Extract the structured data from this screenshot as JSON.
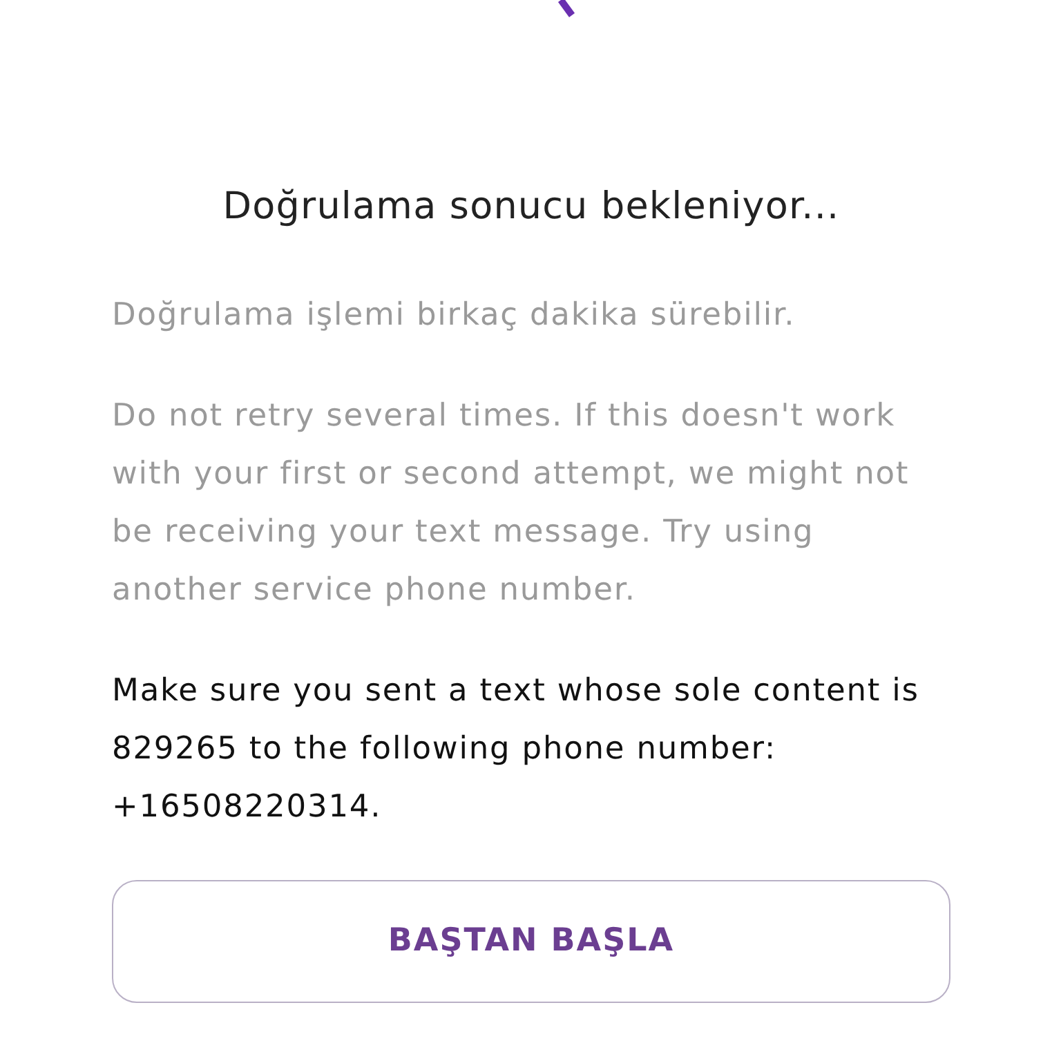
{
  "title": "Doğrulama sonucu bekleniyor...",
  "paragraphs": [
    {
      "kind": "muted",
      "text": "Doğrulama işlemi birkaç dakika sürebilir."
    },
    {
      "kind": "muted",
      "text": "Do not retry several times. If this doesn't work with your first or second attempt, we might not be receiving your text message. Try using another service phone number."
    },
    {
      "kind": "plain",
      "text": "Make sure you sent a text whose sole content is 829265 to the following phone number: +16508220314."
    }
  ],
  "button": {
    "label": "BAŞTAN BAŞLA"
  }
}
